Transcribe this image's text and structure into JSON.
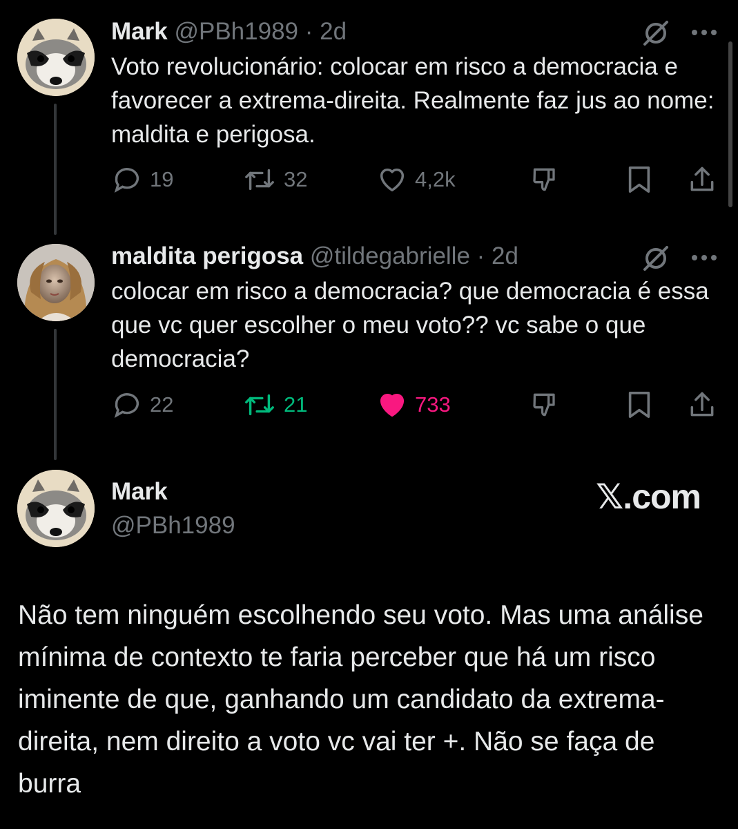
{
  "tweets": [
    {
      "name": "Mark",
      "handle": "@PBh1989",
      "time": "· 2d",
      "text": "Voto revolucionário: colocar em risco a democracia e favorecer a extrema-direita. Realmente faz jus ao nome: maldita e perigosa.",
      "replies": "19",
      "retweets": "32",
      "likes": "4,2k"
    },
    {
      "name": "maldita perigosa",
      "handle": "@tildegabrielle",
      "time": "· 2d",
      "text": "colocar em risco a democracia? que democracia é essa que vc quer escolher o meu voto?? vc sabe o que democracia?",
      "replies": "22",
      "retweets": "21",
      "likes": "733"
    }
  ],
  "main_tweet": {
    "name": "Mark",
    "handle": "@PBh1989",
    "watermark": "𝕏.com",
    "text": "Não tem ninguém escolhendo seu voto. Mas uma análise mínima de contexto te faria perceber que há um risco iminente de que, ganhando um candidato da extrema-direita, nem direito a voto vc vai ter +. Não se faça de burra"
  },
  "icons": [
    "reply-icon",
    "retweet-icon",
    "like-icon",
    "dislike-icon",
    "bookmark-icon",
    "share-icon",
    "grok-icon",
    "more-icon"
  ],
  "colors": {
    "background": "#000000",
    "text": "#e7e9ea",
    "muted": "#71767b",
    "retweet_active": "#00ba7c",
    "like_active": "#f91880"
  }
}
